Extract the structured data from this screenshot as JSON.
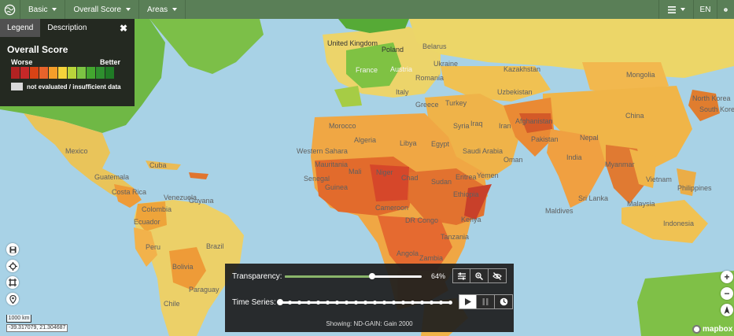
{
  "topbar": {
    "menus": [
      {
        "label": "Basic"
      },
      {
        "label": "Overall Score"
      },
      {
        "label": "Areas"
      }
    ],
    "language": "EN"
  },
  "legend": {
    "tabs": [
      "Legend",
      "Description"
    ],
    "active_tab": "Legend",
    "title": "Overall Score",
    "worse_label": "Worse",
    "better_label": "Better",
    "swatches": [
      "#b22222",
      "#c62828",
      "#d84315",
      "#e8632b",
      "#f59e2a",
      "#f5d33b",
      "#b9d53b",
      "#7cc443",
      "#43a62f",
      "#2e8f2e",
      "#1f7a25"
    ],
    "na_label": "not evaluated / insufficient data"
  },
  "panel": {
    "transparency_label": "Transparency:",
    "transparency_value": "64%",
    "transparency_fraction": 0.64,
    "time_series_label": "Time Series:",
    "time_series_steps": 19,
    "time_series_position": 0,
    "showing": "Showing: ND-GAIN: Gain 2000"
  },
  "map": {
    "scale_label": "1000 km",
    "coords": "-39.317079, 21.304687",
    "attribution": "mapbox",
    "labels": [
      "United Kingdom",
      "Poland",
      "Belarus",
      "Ukraine",
      "France",
      "Austria",
      "Romania",
      "Italy",
      "Greece",
      "Turkey",
      "Kazakhstan",
      "Mongolia",
      "Uzbekistan",
      "North Korea",
      "South Korea",
      "Afghanistan",
      "China",
      "Iran",
      "Iraq",
      "Syria",
      "Pakistan",
      "Nepal",
      "Morocco",
      "Algeria",
      "Libya",
      "Egypt",
      "Saudi Arabia",
      "Oman",
      "Yemen",
      "India",
      "Myanmar",
      "Vietnam",
      "Philippines",
      "Western Sahara",
      "Mauritania",
      "Mali",
      "Niger",
      "Chad",
      "Sudan",
      "Eritrea",
      "Ethiopia",
      "Senegal",
      "Guinea",
      "Cameroon",
      "DR Congo",
      "Kenya",
      "Tanzania",
      "Angola",
      "Zambia",
      "Maldives",
      "Sri Lanka",
      "Malaysia",
      "Indonesia",
      "Mexico",
      "Cuba",
      "Guatemala",
      "Costa Rica",
      "Venezuela",
      "Colombia",
      "Guyana",
      "Ecuador",
      "Peru",
      "Brazil",
      "Bolivia",
      "Paraguay",
      "Chile"
    ]
  }
}
